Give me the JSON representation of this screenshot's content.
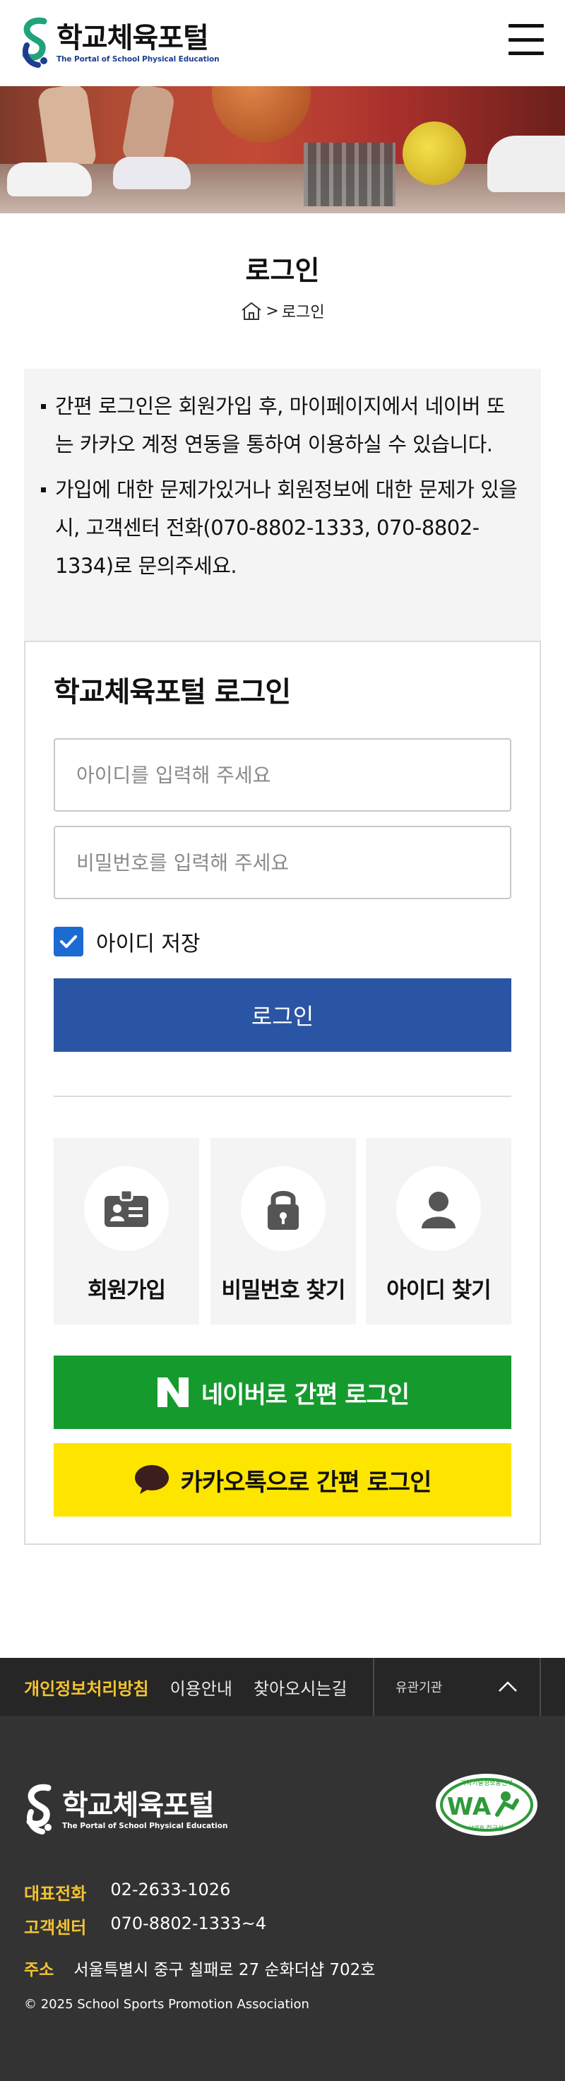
{
  "header": {
    "logo_title": "학교체육포털",
    "logo_subtitle": "The Portal of School Physical Education",
    "menu_icon": "hamburger-menu-icon"
  },
  "page": {
    "title": "로그인",
    "breadcrumb_home_icon": "home-icon",
    "breadcrumb_current": "로그인"
  },
  "notice": {
    "items": [
      "간편 로그인은 회원가입 후, 마이페이지에서 네이버 또는 카카오 계정 연동을 통하여 이용하실 수 있습니다.",
      "가입에 대한 문제가있거나 회원정보에 대한 문제가 있을 시, 고객센터 전화(070-8802-1333, 070-8802-1334)로 문의주세요."
    ]
  },
  "login": {
    "heading": "학교체육포털 로그인",
    "id_placeholder": "아이디를 입력해 주세요",
    "pw_placeholder": "비밀번호를 입력해 주세요",
    "save_id_label": "아이디 저장",
    "save_id_checked": true,
    "login_button": "로그인",
    "cards": [
      {
        "label": "회원가입",
        "icon": "id-card-icon"
      },
      {
        "label": "비밀번호 찾기",
        "icon": "lock-icon"
      },
      {
        "label": "아이디 찾기",
        "icon": "user-icon"
      }
    ],
    "naver_button": "네이버로 간편 로그인",
    "kakao_button": "카카오톡으로 간편 로그인"
  },
  "footer_nav": {
    "links": [
      "개인정보처리방침",
      "이용안내",
      "찾아오시는길"
    ],
    "related": "유관기관"
  },
  "footer": {
    "logo_title": "학교체육포털",
    "logo_subtitle": "The Portal of School Physical Education",
    "wa_badge_top": "과학기술정보통신부",
    "wa_badge_mark": "WA",
    "wa_badge_bottom": "WEB 접근성",
    "phone_label": "대표전화",
    "phone_value": "02-2633-1026",
    "cs_label": "고객센터",
    "cs_value": "070-8802-1333~4",
    "address_label": "주소",
    "address_value": "서울특별시 중구 칠패로 27 순화더샵 702호",
    "copyright": "© 2025 School Sports Promotion Association"
  },
  "colors": {
    "login_button": "#2a55a4",
    "naver": "#159a2e",
    "kakao": "#fee500",
    "footer_accent": "#f2c331",
    "checkbox": "#1b6bd1"
  }
}
